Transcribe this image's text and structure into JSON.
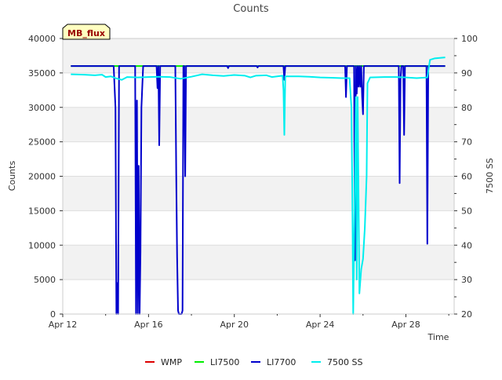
{
  "chart_data": {
    "type": "line",
    "title": "Counts",
    "xlabel": "Time",
    "ylabel": "Counts",
    "y2label": "7500 SS",
    "badge": "MB_flux",
    "x_range": [
      "2021-04-12",
      "2021-04-30 06:00"
    ],
    "x_ticks": [
      "Apr 12",
      "Apr 16",
      "Apr 20",
      "Apr 24",
      "Apr 28"
    ],
    "x_tick_dates": [
      "2021-04-12",
      "2021-04-16",
      "2021-04-20",
      "2021-04-24",
      "2021-04-28"
    ],
    "ylim": [
      0,
      40000
    ],
    "y_ticks": [
      0,
      5000,
      10000,
      15000,
      20000,
      25000,
      30000,
      35000,
      40000
    ],
    "y2lim": [
      20,
      100
    ],
    "y2_ticks": [
      20,
      30,
      40,
      50,
      60,
      70,
      80,
      90,
      100
    ],
    "grid": true,
    "background_bands": true,
    "legend_position": "bottom",
    "colors": {
      "WMP": "#dd0000",
      "LI7500": "#00ee00",
      "LI7700": "#0000cc",
      "7500 SS": "#00eeee",
      "band": "#f2f2f2",
      "grid": "#dddddd",
      "badge_fill": "#ffffc0",
      "badge_text": "#990000"
    },
    "series": [
      {
        "name": "WMP",
        "axis": "left",
        "points": []
      },
      {
        "name": "LI7500",
        "axis": "left",
        "points": [
          [
            "2021-04-12 09:00",
            36000
          ],
          [
            "2021-04-14 12:00",
            36000
          ],
          [
            "2021-04-15 00:00",
            36000
          ],
          [
            "2021-04-15 12:00",
            36000
          ],
          [
            "2021-04-16 12:00",
            36000
          ],
          [
            "2021-04-17 12:00",
            36000
          ],
          [
            "2021-04-17 18:00",
            36000
          ],
          [
            "2021-04-18 00:00",
            36000
          ],
          [
            "2021-04-29 20:00",
            36000
          ]
        ]
      },
      {
        "name": "LI7700",
        "axis": "left",
        "points": [
          [
            "2021-04-12 09:00",
            36000
          ],
          [
            "2021-04-14 09:00",
            36000
          ],
          [
            "2021-04-14 11:00",
            30000
          ],
          [
            "2021-04-14 12:00",
            0
          ],
          [
            "2021-04-14 13:00",
            4500
          ],
          [
            "2021-04-14 14:00",
            0
          ],
          [
            "2021-04-14 15:00",
            36000
          ],
          [
            "2021-04-15 09:00",
            36000
          ],
          [
            "2021-04-15 10:00",
            0
          ],
          [
            "2021-04-15 11:00",
            31000
          ],
          [
            "2021-04-15 12:00",
            0
          ],
          [
            "2021-04-15 13:00",
            21500
          ],
          [
            "2021-04-15 14:00",
            0
          ],
          [
            "2021-04-15 15:00",
            9000
          ],
          [
            "2021-04-15 16:00",
            30000
          ],
          [
            "2021-04-15 18:00",
            36000
          ],
          [
            "2021-04-16 09:00",
            36000
          ],
          [
            "2021-04-16 10:00",
            32800
          ],
          [
            "2021-04-16 11:00",
            36000
          ],
          [
            "2021-04-16 12:00",
            24500
          ],
          [
            "2021-04-16 13:00",
            36000
          ],
          [
            "2021-04-17 06:00",
            36000
          ],
          [
            "2021-04-17 07:00",
            20000
          ],
          [
            "2021-04-17 08:00",
            8300
          ],
          [
            "2021-04-17 09:00",
            500
          ],
          [
            "2021-04-17 10:00",
            0
          ],
          [
            "2021-04-17 13:00",
            0
          ],
          [
            "2021-04-17 14:00",
            500
          ],
          [
            "2021-04-17 15:00",
            36000
          ],
          [
            "2021-04-17 16:00",
            36000
          ],
          [
            "2021-04-17 17:00",
            20000
          ],
          [
            "2021-04-17 18:00",
            36000
          ],
          [
            "2021-04-19 16:00",
            36000
          ],
          [
            "2021-04-19 17:00",
            35700
          ],
          [
            "2021-04-19 18:00",
            36000
          ],
          [
            "2021-04-21 01:00",
            36000
          ],
          [
            "2021-04-21 02:00",
            35800
          ],
          [
            "2021-04-21 03:00",
            36000
          ],
          [
            "2021-04-22 07:00",
            36000
          ],
          [
            "2021-04-22 08:00",
            34000
          ],
          [
            "2021-04-22 09:00",
            36000
          ],
          [
            "2021-04-25 04:00",
            36000
          ],
          [
            "2021-04-25 05:00",
            31500
          ],
          [
            "2021-04-25 06:00",
            36000
          ],
          [
            "2021-04-25 14:00",
            36000
          ],
          [
            "2021-04-25 15:00",
            7800
          ],
          [
            "2021-04-25 16:00",
            36000
          ],
          [
            "2021-04-25 17:00",
            32000
          ],
          [
            "2021-04-25 18:00",
            36000
          ],
          [
            "2021-04-25 19:00",
            33000
          ],
          [
            "2021-04-25 20:00",
            36000
          ],
          [
            "2021-04-25 21:00",
            33000
          ],
          [
            "2021-04-25 22:00",
            36000
          ],
          [
            "2021-04-25 23:00",
            31500
          ],
          [
            "2021-04-26 00:00",
            29000
          ],
          [
            "2021-04-26 01:00",
            36000
          ],
          [
            "2021-04-27 16:00",
            36000
          ],
          [
            "2021-04-27 17:00",
            19000
          ],
          [
            "2021-04-27 18:00",
            34000
          ],
          [
            "2021-04-27 19:00",
            36000
          ],
          [
            "2021-04-27 21:00",
            36000
          ],
          [
            "2021-04-27 22:00",
            26000
          ],
          [
            "2021-04-27 23:00",
            36000
          ],
          [
            "2021-04-28 23:00",
            36000
          ],
          [
            "2021-04-29 00:00",
            10200
          ],
          [
            "2021-04-29 01:00",
            36000
          ],
          [
            "2021-04-29 20:00",
            36000
          ]
        ]
      },
      {
        "name": "7500 SS",
        "axis": "right",
        "points": [
          [
            "2021-04-12 09:00",
            89.6
          ],
          [
            "2021-04-13 00:00",
            89.5
          ],
          [
            "2021-04-13 12:00",
            89.3
          ],
          [
            "2021-04-13 20:00",
            89.5
          ],
          [
            "2021-04-14 00:00",
            88.8
          ],
          [
            "2021-04-14 06:00",
            89.0
          ],
          [
            "2021-04-14 12:00",
            88.4
          ],
          [
            "2021-04-14 18:00",
            88.0
          ],
          [
            "2021-04-15 00:00",
            88.8
          ],
          [
            "2021-04-15 12:00",
            88.7
          ],
          [
            "2021-04-16 00:00",
            88.8
          ],
          [
            "2021-04-16 12:00",
            88.9
          ],
          [
            "2021-04-17 00:00",
            88.8
          ],
          [
            "2021-04-17 12:00",
            88.3
          ],
          [
            "2021-04-18 00:00",
            88.9
          ],
          [
            "2021-04-18 12:00",
            89.6
          ],
          [
            "2021-04-19 00:00",
            89.3
          ],
          [
            "2021-04-19 12:00",
            89.1
          ],
          [
            "2021-04-20 00:00",
            89.4
          ],
          [
            "2021-04-20 12:00",
            89.2
          ],
          [
            "2021-04-20 18:00",
            88.7
          ],
          [
            "2021-04-21 00:00",
            89.2
          ],
          [
            "2021-04-21 12:00",
            89.3
          ],
          [
            "2021-04-21 18:00",
            88.8
          ],
          [
            "2021-04-22 06:00",
            89.2
          ],
          [
            "2021-04-22 07:00",
            85.0
          ],
          [
            "2021-04-22 08:00",
            72.0
          ],
          [
            "2021-04-22 09:00",
            89.0
          ],
          [
            "2021-04-23 00:00",
            89.0
          ],
          [
            "2021-04-23 12:00",
            88.9
          ],
          [
            "2021-04-24 00:00",
            88.7
          ],
          [
            "2021-04-24 12:00",
            88.6
          ],
          [
            "2021-04-25 00:00",
            88.5
          ],
          [
            "2021-04-25 09:00",
            88.5
          ],
          [
            "2021-04-25 11:00",
            80.0
          ],
          [
            "2021-04-25 12:00",
            57.0
          ],
          [
            "2021-04-25 13:00",
            20.0
          ],
          [
            "2021-04-25 15:00",
            60.0
          ],
          [
            "2021-04-25 16:00",
            83.0
          ],
          [
            "2021-04-25 17:00",
            30.0
          ],
          [
            "2021-04-25 18:00",
            83.0
          ],
          [
            "2021-04-25 20:00",
            26.0
          ],
          [
            "2021-04-25 22:00",
            33.0
          ],
          [
            "2021-04-26 00:00",
            36.0
          ],
          [
            "2021-04-26 02:00",
            45.0
          ],
          [
            "2021-04-26 04:00",
            60.0
          ],
          [
            "2021-04-26 05:00",
            87.0
          ],
          [
            "2021-04-26 08:00",
            88.7
          ],
          [
            "2021-04-27 00:00",
            88.8
          ],
          [
            "2021-04-27 12:00",
            88.8
          ],
          [
            "2021-04-28 00:00",
            88.7
          ],
          [
            "2021-04-28 12:00",
            88.5
          ],
          [
            "2021-04-29 00:00",
            88.7
          ],
          [
            "2021-04-29 03:00",
            93.8
          ],
          [
            "2021-04-29 08:00",
            94.2
          ],
          [
            "2021-04-29 20:00",
            94.5
          ]
        ]
      }
    ]
  }
}
